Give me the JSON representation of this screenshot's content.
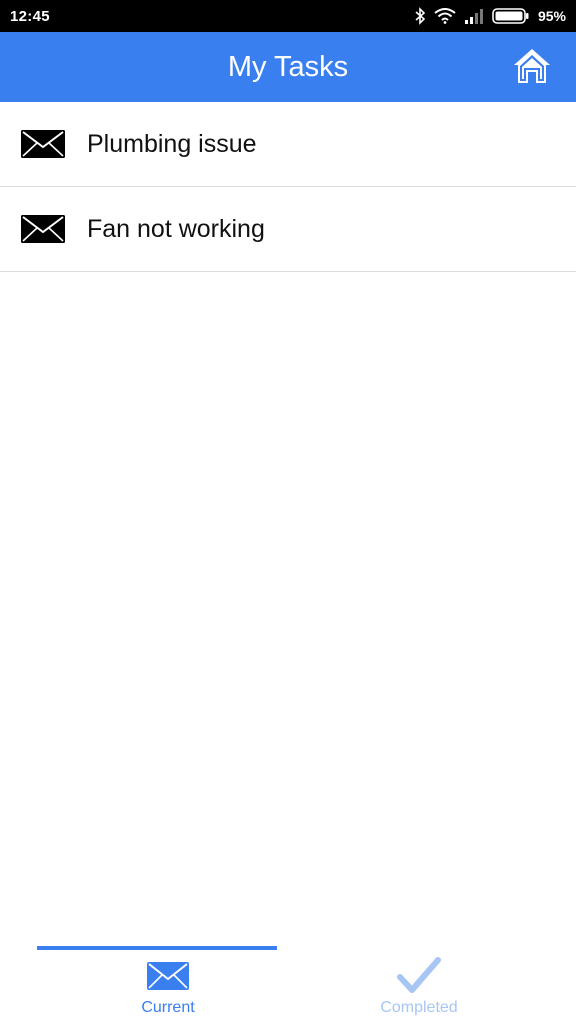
{
  "status_bar": {
    "time": "12:45",
    "battery_percent": "95%",
    "icons": [
      "bluetooth-icon",
      "wifi-icon",
      "signal-icon",
      "battery-icon"
    ]
  },
  "header": {
    "title": "My Tasks",
    "home_icon": "home-icon",
    "background_color": "#3a7ff0"
  },
  "tasks": [
    {
      "label": "Plumbing issue",
      "icon": "envelope-icon"
    },
    {
      "label": "Fan not working",
      "icon": "envelope-icon"
    }
  ],
  "tabs": [
    {
      "label": "Current",
      "icon": "envelope-icon",
      "active": true,
      "color": "#3a7ff0"
    },
    {
      "label": "Completed",
      "icon": "checkmark-icon",
      "active": false,
      "color": "#a8c6f4"
    }
  ]
}
